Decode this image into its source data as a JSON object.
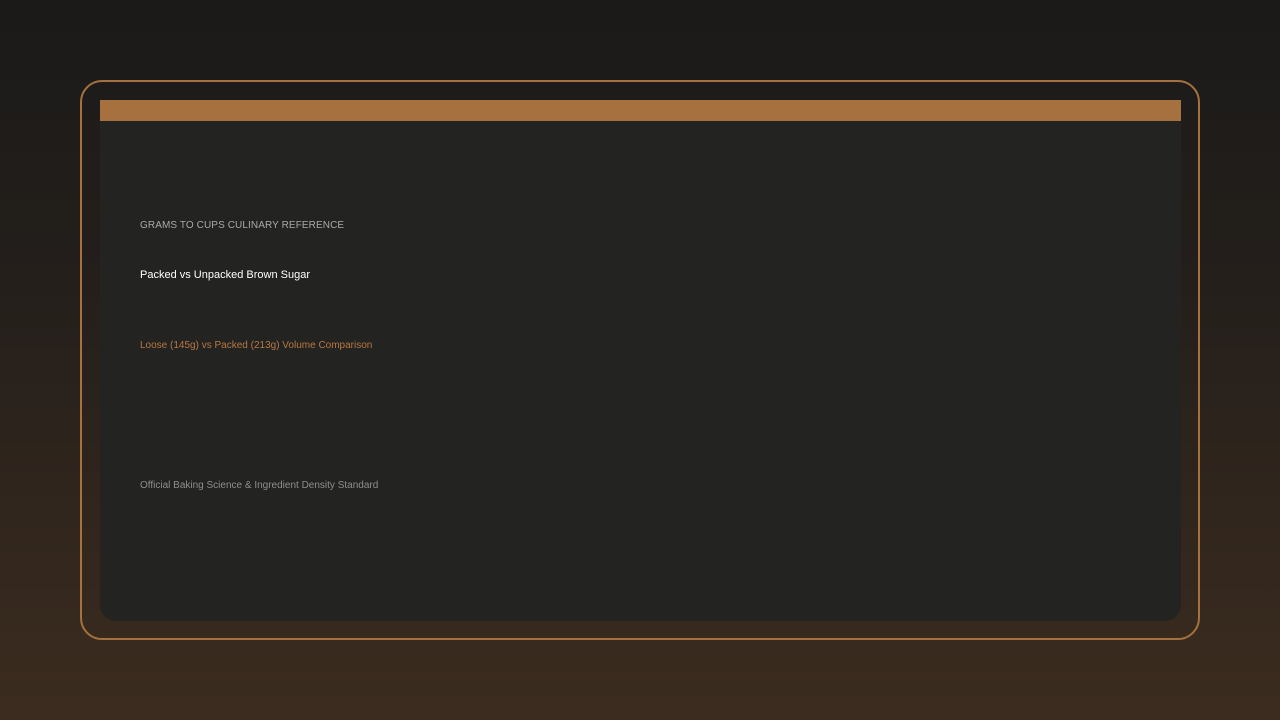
{
  "card": {
    "eyebrow": "GRAMS TO CUPS CULINARY REFERENCE",
    "title": "Packed vs Unpacked Brown Sugar",
    "subtitle": "Loose (145g) vs Packed (213g) Volume Comparison",
    "footer": "Official Baking Science & Ingredient Density Standard"
  },
  "colors": {
    "accent": "#a6713f",
    "panel": "#232322",
    "subtitle": "#b9783f"
  }
}
